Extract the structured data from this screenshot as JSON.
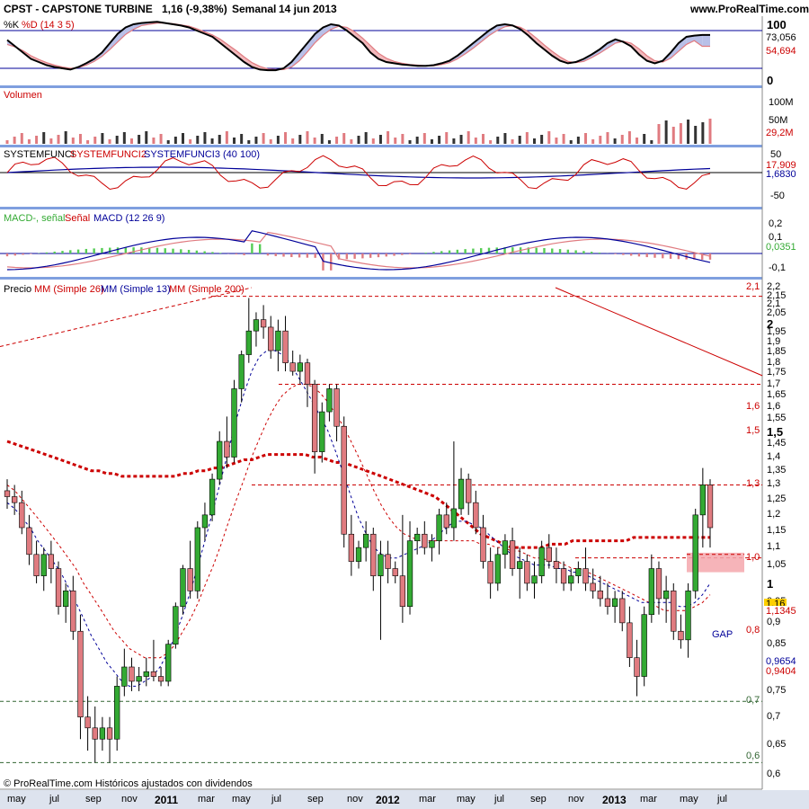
{
  "header": {
    "title": "CPST - CAPSTONE TURBINE",
    "quote": "1,16 (-9,38%)",
    "period": "Semanal",
    "date": "14 jun 2013",
    "site": "www.ProRealTime.com"
  },
  "footer": "© ProRealTime.com  Históricos ajustados con dividendos",
  "colors": {
    "up": "#33aa33",
    "down": "#e07b80",
    "mm26": "#cc0000",
    "mm13": "#000099",
    "mm200": "#cc0000",
    "panel_border": "#7f9fdf"
  },
  "panels": {
    "stoch": {
      "label_k": "%K",
      "label_d": "%D (14 3 5)",
      "ticks": [
        "100",
        "0"
      ],
      "value_k": "73,056",
      "value_d": "54,694",
      "levels": [
        80,
        20
      ]
    },
    "volume": {
      "label": "Volumen",
      "ticks": [
        "100M",
        "50M"
      ],
      "value": "29,2M"
    },
    "system": {
      "label1": "SYSTEMFUNCI",
      "label2": "SYSTEMFUNCI2",
      "label3": "SYSTEMFUNCI3 (40 100)",
      "ticks": [
        "50",
        "-50"
      ],
      "value1": "17,909",
      "value2": "1,6830"
    },
    "macd": {
      "label1": "MACD-, señal",
      "label2": "Señal",
      "label3": "MACD (12 26 9)",
      "ticks": [
        "0,2",
        "0,1",
        "-0,1"
      ],
      "value": "0,0351"
    },
    "price": {
      "label1": "Precio",
      "label2": "MM (Simple 26)",
      "label3": "MM (Simple 13)",
      "label4": "MM (Simple 200)",
      "ticks": [
        "2,2",
        "2,15",
        "2,1",
        "2,05",
        "2",
        "1,95",
        "1,9",
        "1,85",
        "1,8",
        "1,75",
        "1,7",
        "1,65",
        "1,6",
        "1,55",
        "1,5",
        "1,45",
        "1,4",
        "1,35",
        "1,3",
        "1,25",
        "1,2",
        "1,15",
        "1,1",
        "1,05",
        "1",
        "0,95",
        "0,9",
        "0,85",
        "0,8",
        "0,75",
        "0,7",
        "0,65",
        "0,6"
      ],
      "last_price": "1,16",
      "mm200_value": "1,1345",
      "mm26_value": "0,9654",
      "mm13_value": "0,9404",
      "fib_labels": [
        "2,1",
        "1,6",
        "1,5",
        "1,3",
        "1,0",
        "0,8",
        "0,7",
        "0,6"
      ],
      "gap_label": "GAP"
    }
  },
  "x_axis": [
    "may",
    "jul",
    "sep",
    "nov",
    "2011",
    "mar",
    "may",
    "jul",
    "sep",
    "nov",
    "2012",
    "mar",
    "may",
    "jul",
    "sep",
    "nov",
    "2013",
    "mar",
    "may",
    "jul"
  ],
  "chart_data": {
    "type": "candlestick",
    "title": "CPST - CAPSTONE TURBINE",
    "period": "weekly",
    "ylim": [
      0.6,
      2.2
    ],
    "yscale": "log",
    "x_range": [
      "2010-05",
      "2013-07"
    ],
    "indicators": [
      "Stochastic %K %D (14 3 5)",
      "Volumen",
      "SYSTEMFUNCI (40 100)",
      "MACD (12 26 9)",
      "MM Simple 26",
      "MM Simple 13",
      "MM Simple 200"
    ],
    "last_close": 1.16,
    "change_pct": -9.38,
    "horizontal_levels": [
      2.15,
      1.7,
      1.3,
      1.07,
      0.73,
      0.62
    ],
    "candles": [
      {
        "o": 1.28,
        "h": 1.32,
        "l": 1.22,
        "c": 1.26
      },
      {
        "o": 1.26,
        "h": 1.3,
        "l": 1.2,
        "c": 1.24
      },
      {
        "o": 1.24,
        "h": 1.28,
        "l": 1.14,
        "c": 1.16
      },
      {
        "o": 1.16,
        "h": 1.2,
        "l": 1.05,
        "c": 1.08
      },
      {
        "o": 1.08,
        "h": 1.12,
        "l": 1.0,
        "c": 1.02
      },
      {
        "o": 1.02,
        "h": 1.1,
        "l": 0.98,
        "c": 1.08
      },
      {
        "o": 1.08,
        "h": 1.12,
        "l": 1.0,
        "c": 1.04
      },
      {
        "o": 1.04,
        "h": 1.06,
        "l": 0.92,
        "c": 0.94
      },
      {
        "o": 0.94,
        "h": 1.0,
        "l": 0.9,
        "c": 0.98
      },
      {
        "o": 0.98,
        "h": 1.02,
        "l": 0.86,
        "c": 0.88
      },
      {
        "o": 0.88,
        "h": 0.92,
        "l": 0.66,
        "c": 0.7
      },
      {
        "o": 0.7,
        "h": 0.74,
        "l": 0.64,
        "c": 0.68
      },
      {
        "o": 0.68,
        "h": 0.72,
        "l": 0.62,
        "c": 0.66
      },
      {
        "o": 0.66,
        "h": 0.7,
        "l": 0.64,
        "c": 0.68
      },
      {
        "o": 0.68,
        "h": 0.7,
        "l": 0.62,
        "c": 0.66
      },
      {
        "o": 0.66,
        "h": 0.78,
        "l": 0.64,
        "c": 0.76
      },
      {
        "o": 0.76,
        "h": 0.84,
        "l": 0.74,
        "c": 0.8
      },
      {
        "o": 0.8,
        "h": 0.82,
        "l": 0.75,
        "c": 0.77
      },
      {
        "o": 0.77,
        "h": 0.8,
        "l": 0.75,
        "c": 0.78
      },
      {
        "o": 0.78,
        "h": 0.82,
        "l": 0.76,
        "c": 0.79
      },
      {
        "o": 0.79,
        "h": 0.86,
        "l": 0.77,
        "c": 0.78
      },
      {
        "o": 0.78,
        "h": 0.8,
        "l": 0.76,
        "c": 0.77
      },
      {
        "o": 0.77,
        "h": 0.86,
        "l": 0.76,
        "c": 0.85
      },
      {
        "o": 0.85,
        "h": 0.95,
        "l": 0.84,
        "c": 0.94
      },
      {
        "o": 0.94,
        "h": 1.05,
        "l": 0.92,
        "c": 1.04
      },
      {
        "o": 1.04,
        "h": 1.12,
        "l": 0.96,
        "c": 0.98
      },
      {
        "o": 0.98,
        "h": 1.18,
        "l": 0.96,
        "c": 1.16
      },
      {
        "o": 1.16,
        "h": 1.24,
        "l": 1.12,
        "c": 1.2
      },
      {
        "o": 1.2,
        "h": 1.34,
        "l": 1.18,
        "c": 1.32
      },
      {
        "o": 1.32,
        "h": 1.5,
        "l": 1.3,
        "c": 1.46
      },
      {
        "o": 1.46,
        "h": 1.56,
        "l": 1.36,
        "c": 1.4
      },
      {
        "o": 1.4,
        "h": 1.72,
        "l": 1.38,
        "c": 1.68
      },
      {
        "o": 1.68,
        "h": 1.86,
        "l": 1.62,
        "c": 1.84
      },
      {
        "o": 1.84,
        "h": 2.14,
        "l": 1.8,
        "c": 1.96
      },
      {
        "o": 1.96,
        "h": 2.06,
        "l": 1.88,
        "c": 2.02
      },
      {
        "o": 2.02,
        "h": 2.1,
        "l": 1.92,
        "c": 1.98
      },
      {
        "o": 1.98,
        "h": 2.04,
        "l": 1.82,
        "c": 1.86
      },
      {
        "o": 1.86,
        "h": 2.02,
        "l": 1.76,
        "c": 1.96
      },
      {
        "o": 1.96,
        "h": 2.04,
        "l": 1.76,
        "c": 1.8
      },
      {
        "o": 1.8,
        "h": 1.86,
        "l": 1.74,
        "c": 1.76
      },
      {
        "o": 1.76,
        "h": 1.84,
        "l": 1.7,
        "c": 1.8
      },
      {
        "o": 1.8,
        "h": 1.82,
        "l": 1.6,
        "c": 1.7
      },
      {
        "o": 1.7,
        "h": 1.72,
        "l": 1.34,
        "c": 1.42
      },
      {
        "o": 1.42,
        "h": 1.62,
        "l": 1.38,
        "c": 1.58
      },
      {
        "o": 1.58,
        "h": 1.7,
        "l": 1.54,
        "c": 1.68
      },
      {
        "o": 1.68,
        "h": 1.7,
        "l": 1.46,
        "c": 1.52
      },
      {
        "o": 1.52,
        "h": 1.56,
        "l": 1.1,
        "c": 1.14
      },
      {
        "o": 1.14,
        "h": 1.2,
        "l": 1.02,
        "c": 1.06
      },
      {
        "o": 1.06,
        "h": 1.12,
        "l": 1.04,
        "c": 1.1
      },
      {
        "o": 1.1,
        "h": 1.18,
        "l": 1.06,
        "c": 1.14
      },
      {
        "o": 1.14,
        "h": 1.16,
        "l": 0.98,
        "c": 1.02
      },
      {
        "o": 1.02,
        "h": 1.12,
        "l": 0.86,
        "c": 1.08
      },
      {
        "o": 1.08,
        "h": 1.12,
        "l": 1.0,
        "c": 1.04
      },
      {
        "o": 1.04,
        "h": 1.06,
        "l": 1.0,
        "c": 1.02
      },
      {
        "o": 1.02,
        "h": 1.2,
        "l": 0.9,
        "c": 0.94
      },
      {
        "o": 0.94,
        "h": 1.18,
        "l": 0.92,
        "c": 1.12
      },
      {
        "o": 1.12,
        "h": 1.16,
        "l": 1.08,
        "c": 1.14
      },
      {
        "o": 1.14,
        "h": 1.18,
        "l": 1.08,
        "c": 1.1
      },
      {
        "o": 1.1,
        "h": 1.14,
        "l": 1.06,
        "c": 1.12
      },
      {
        "o": 1.12,
        "h": 1.22,
        "l": 1.08,
        "c": 1.2
      },
      {
        "o": 1.2,
        "h": 1.24,
        "l": 1.14,
        "c": 1.16
      },
      {
        "o": 1.16,
        "h": 1.46,
        "l": 1.12,
        "c": 1.22
      },
      {
        "o": 1.22,
        "h": 1.36,
        "l": 1.2,
        "c": 1.32
      },
      {
        "o": 1.32,
        "h": 1.34,
        "l": 1.2,
        "c": 1.24
      },
      {
        "o": 1.24,
        "h": 1.28,
        "l": 1.14,
        "c": 1.16
      },
      {
        "o": 1.16,
        "h": 1.2,
        "l": 1.04,
        "c": 1.06
      },
      {
        "o": 1.06,
        "h": 1.1,
        "l": 0.96,
        "c": 1.0
      },
      {
        "o": 1.0,
        "h": 1.1,
        "l": 0.98,
        "c": 1.08
      },
      {
        "o": 1.08,
        "h": 1.14,
        "l": 1.04,
        "c": 1.12
      },
      {
        "o": 1.12,
        "h": 1.16,
        "l": 1.02,
        "c": 1.04
      },
      {
        "o": 1.04,
        "h": 1.1,
        "l": 0.96,
        "c": 1.06
      },
      {
        "o": 1.06,
        "h": 1.08,
        "l": 0.98,
        "c": 1.0
      },
      {
        "o": 1.0,
        "h": 1.06,
        "l": 0.96,
        "c": 1.02
      },
      {
        "o": 1.02,
        "h": 1.12,
        "l": 1.0,
        "c": 1.1
      },
      {
        "o": 1.1,
        "h": 1.14,
        "l": 1.04,
        "c": 1.06
      },
      {
        "o": 1.06,
        "h": 1.1,
        "l": 1.0,
        "c": 1.04
      },
      {
        "o": 1.04,
        "h": 1.06,
        "l": 0.98,
        "c": 1.0
      },
      {
        "o": 1.0,
        "h": 1.04,
        "l": 0.98,
        "c": 1.02
      },
      {
        "o": 1.02,
        "h": 1.06,
        "l": 1.0,
        "c": 1.04
      },
      {
        "o": 1.04,
        "h": 1.1,
        "l": 0.98,
        "c": 1.0
      },
      {
        "o": 1.0,
        "h": 1.04,
        "l": 0.96,
        "c": 0.98
      },
      {
        "o": 0.98,
        "h": 1.02,
        "l": 0.94,
        "c": 0.96
      },
      {
        "o": 0.96,
        "h": 1.0,
        "l": 0.92,
        "c": 0.94
      },
      {
        "o": 0.94,
        "h": 0.98,
        "l": 0.9,
        "c": 0.96
      },
      {
        "o": 0.96,
        "h": 0.98,
        "l": 0.88,
        "c": 0.9
      },
      {
        "o": 0.9,
        "h": 0.94,
        "l": 0.8,
        "c": 0.82
      },
      {
        "o": 0.82,
        "h": 0.86,
        "l": 0.74,
        "c": 0.78
      },
      {
        "o": 0.78,
        "h": 0.94,
        "l": 0.76,
        "c": 0.92
      },
      {
        "o": 0.92,
        "h": 1.08,
        "l": 0.9,
        "c": 1.04
      },
      {
        "o": 1.04,
        "h": 1.06,
        "l": 0.92,
        "c": 0.96
      },
      {
        "o": 0.96,
        "h": 1.02,
        "l": 0.9,
        "c": 0.98
      },
      {
        "o": 0.98,
        "h": 1.0,
        "l": 0.86,
        "c": 0.88
      },
      {
        "o": 0.88,
        "h": 0.92,
        "l": 0.84,
        "c": 0.86
      },
      {
        "o": 0.86,
        "h": 1.0,
        "l": 0.82,
        "c": 0.98
      },
      {
        "o": 0.98,
        "h": 1.22,
        "l": 0.96,
        "c": 1.2
      },
      {
        "o": 1.2,
        "h": 1.36,
        "l": 1.1,
        "c": 1.3
      },
      {
        "o": 1.3,
        "h": 1.32,
        "l": 1.1,
        "c": 1.16
      }
    ],
    "mm13": [
      1.24,
      1.22,
      1.19,
      1.16,
      1.12,
      1.09,
      1.06,
      1.03,
      0.99,
      0.95,
      0.91,
      0.87,
      0.84,
      0.81,
      0.79,
      0.77,
      0.76,
      0.76,
      0.77,
      0.78,
      0.8,
      0.83,
      0.87,
      0.92,
      0.98,
      1.05,
      1.13,
      1.22,
      1.32,
      1.43,
      1.55,
      1.66,
      1.76,
      1.83,
      1.86,
      1.86,
      1.84,
      1.8,
      1.74,
      1.68,
      1.62,
      1.56,
      1.5,
      1.42,
      1.34,
      1.26,
      1.19,
      1.14,
      1.1,
      1.08,
      1.07,
      1.07,
      1.08,
      1.09,
      1.1,
      1.11,
      1.13,
      1.15,
      1.17,
      1.18,
      1.18,
      1.17,
      1.16,
      1.14,
      1.12,
      1.1,
      1.08,
      1.07,
      1.06,
      1.05,
      1.05,
      1.05,
      1.04,
      1.04,
      1.03,
      1.03,
      1.02,
      1.01,
      1.0,
      0.99,
      0.98,
      0.97,
      0.96,
      0.95,
      0.95,
      0.95,
      0.95,
      0.95,
      0.94,
      0.94,
      0.95,
      0.97,
      1.0
    ],
    "mm26": [
      1.3,
      1.28,
      1.25,
      1.22,
      1.19,
      1.16,
      1.13,
      1.1,
      1.07,
      1.04,
      1.0,
      0.97,
      0.94,
      0.91,
      0.88,
      0.86,
      0.84,
      0.83,
      0.82,
      0.82,
      0.82,
      0.83,
      0.85,
      0.88,
      0.91,
      0.95,
      1.0,
      1.05,
      1.11,
      1.18,
      1.25,
      1.32,
      1.4,
      1.47,
      1.54,
      1.6,
      1.65,
      1.68,
      1.7,
      1.7,
      1.69,
      1.66,
      1.62,
      1.57,
      1.52,
      1.46,
      1.4,
      1.34,
      1.28,
      1.23,
      1.19,
      1.16,
      1.14,
      1.13,
      1.12,
      1.12,
      1.12,
      1.12,
      1.12,
      1.12,
      1.12,
      1.12,
      1.11,
      1.11,
      1.1,
      1.1,
      1.09,
      1.09,
      1.08,
      1.07,
      1.07,
      1.06,
      1.06,
      1.05,
      1.04,
      1.04,
      1.03,
      1.02,
      1.01,
      1.0,
      0.99,
      0.98,
      0.97,
      0.96,
      0.95,
      0.94,
      0.93,
      0.93,
      0.93,
      0.93,
      0.94,
      0.95,
      0.97
    ],
    "mm200": [
      1.46,
      1.45,
      1.44,
      1.43,
      1.42,
      1.41,
      1.4,
      1.39,
      1.38,
      1.37,
      1.36,
      1.35,
      1.35,
      1.34,
      1.34,
      1.33,
      1.33,
      1.33,
      1.33,
      1.33,
      1.33,
      1.33,
      1.33,
      1.34,
      1.34,
      1.35,
      1.35,
      1.36,
      1.36,
      1.37,
      1.38,
      1.39,
      1.39,
      1.4,
      1.41,
      1.41,
      1.41,
      1.41,
      1.41,
      1.41,
      1.4,
      1.4,
      1.39,
      1.38,
      1.38,
      1.37,
      1.36,
      1.35,
      1.34,
      1.33,
      1.32,
      1.31,
      1.3,
      1.29,
      1.28,
      1.27,
      1.26,
      1.24,
      1.22,
      1.2,
      1.18,
      1.16,
      1.14,
      1.13,
      1.12,
      1.11,
      1.1,
      1.1,
      1.1,
      1.1,
      1.1,
      1.11,
      1.11,
      1.11,
      1.12,
      1.12,
      1.12,
      1.12,
      1.12,
      1.12,
      1.12,
      1.12,
      1.13,
      1.13,
      1.13,
      1.13,
      1.13,
      1.13,
      1.13,
      1.13,
      1.13,
      1.13,
      1.13
    ],
    "stoch_k": [
      65,
      55,
      45,
      35,
      30,
      25,
      22,
      20,
      18,
      22,
      28,
      35,
      45,
      60,
      75,
      85,
      90,
      92,
      93,
      94,
      92,
      90,
      88,
      85,
      80,
      75,
      70,
      60,
      50,
      40,
      30,
      22,
      18,
      17,
      17,
      20,
      30,
      45,
      60,
      75,
      85,
      90,
      88,
      80,
      70,
      60,
      45,
      35,
      30,
      28,
      26,
      25,
      24,
      24,
      25,
      28,
      32,
      40,
      50,
      60,
      70,
      80,
      88,
      90,
      88,
      82,
      72,
      60,
      50,
      40,
      32,
      28,
      30,
      35,
      42,
      50,
      60,
      66,
      62,
      55,
      42,
      32,
      28,
      32,
      45,
      60,
      70,
      72,
      73,
      73
    ],
    "stoch_d": [
      58,
      54,
      48,
      40,
      34,
      29,
      25,
      22,
      20,
      21,
      25,
      31,
      39,
      50,
      62,
      74,
      82,
      88,
      90,
      92,
      92,
      91,
      89,
      87,
      83,
      78,
      73,
      66,
      57,
      48,
      38,
      29,
      23,
      19,
      18,
      18,
      22,
      32,
      46,
      61,
      73,
      82,
      87,
      85,
      78,
      68,
      56,
      44,
      36,
      31,
      28,
      26,
      25,
      24,
      24,
      26,
      29,
      35,
      43,
      52,
      62,
      72,
      80,
      86,
      88,
      85,
      78,
      68,
      57,
      47,
      38,
      31,
      29,
      31,
      37,
      44,
      52,
      60,
      63,
      60,
      51,
      40,
      32,
      30,
      36,
      47,
      58,
      64,
      55,
      55
    ]
  }
}
